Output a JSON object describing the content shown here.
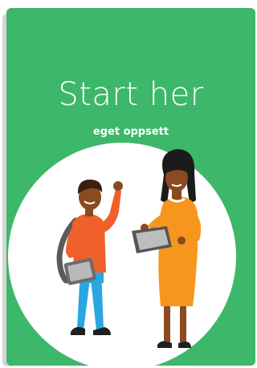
{
  "card": {
    "title": "Start her",
    "subtitle": "eget oppsett",
    "background_color": "#3db76a",
    "circle_color": "#ffffff",
    "illustration_icons": [
      "student-icon",
      "teacher-icon",
      "tablet-icon"
    ]
  }
}
